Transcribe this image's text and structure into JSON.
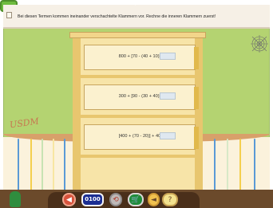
{
  "instruction": {
    "text": "Bei diesen Termen kommen ineinander verschachtelte Klammern vor. Rechne die inneren Klammern zuerst!"
  },
  "terms": [
    {
      "expression": "800 + [70 - (40 + 10)] =",
      "answer": ""
    },
    {
      "expression": "300 + [90 - (30 + 40)] =",
      "answer": ""
    },
    {
      "expression": "[400 + (70 - 20)] + 40 =",
      "answer": ""
    }
  ],
  "toolbar": {
    "counter": "0100"
  },
  "decor": {
    "signature": "USDM"
  },
  "colors": {
    "wall": "#b4d371",
    "shelf": "#f7e4a8",
    "input": "#dfe8f0",
    "counter": "#1c2e92"
  },
  "icons": {
    "instruction": "document-icon",
    "potion": "potion-icon",
    "red": "arrow-left-icon",
    "counter": "counter-display-icon",
    "arrow": "arrow-refresh-icon",
    "cart": "cart-icon",
    "megaphone": "megaphone-icon",
    "hint": "hint-icon",
    "check": "checkmark-icon",
    "spiderweb": "spiderweb-icon"
  }
}
